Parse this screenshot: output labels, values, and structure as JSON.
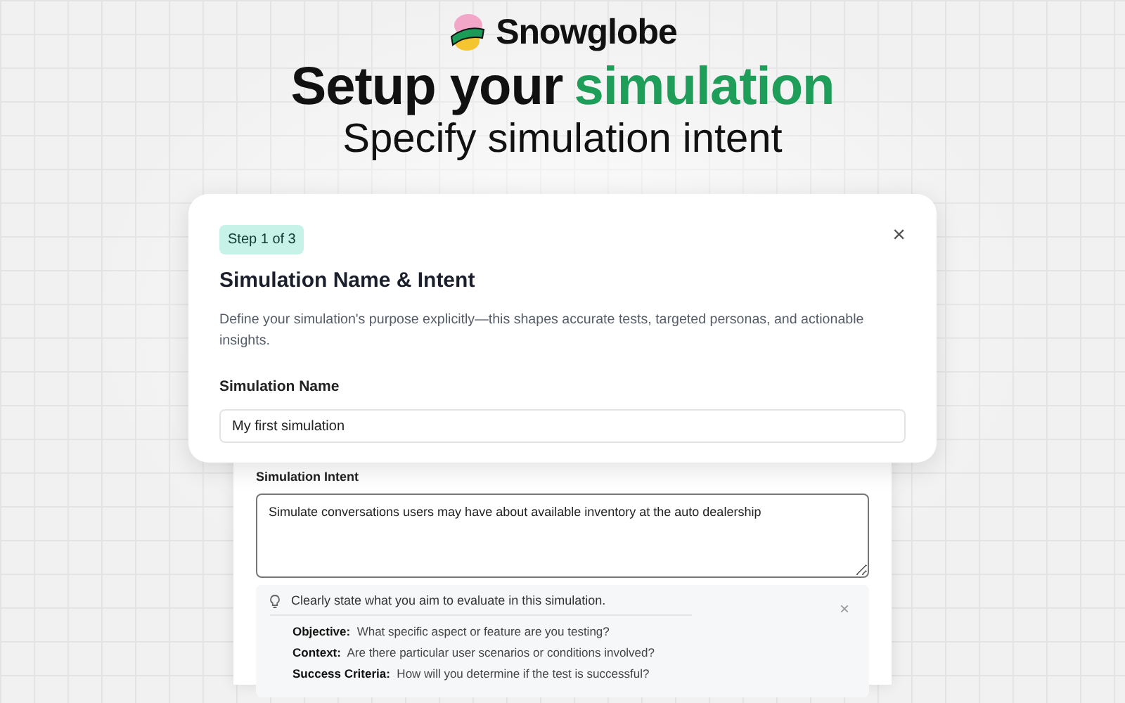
{
  "brand": {
    "name": "Snowglobe"
  },
  "headline": {
    "lead": "Setup your",
    "accent": "simulation"
  },
  "subtitle": "Specify simulation intent",
  "dialog": {
    "step": "Step 1 of 3",
    "title": "Simulation Name & Intent",
    "description": "Define your simulation's purpose explicitly—this shapes accurate tests, targeted personas, and actionable insights.",
    "close": "×",
    "name_label": "Simulation Name",
    "name_value": "My first simulation"
  },
  "intent": {
    "label": "Simulation Intent",
    "value": "Simulate conversations users may have about available inventory at the auto dealership",
    "tip": {
      "text": "Clearly state what you aim to evaluate in this simulation.",
      "close": "×",
      "items": [
        {
          "text": "**Objective:**  What specific aspect or feature are you testing?"
        },
        {
          "text": "**Context:**  Are there particular user scenarios or conditions involved?"
        },
        {
          "text": "**Success Criteria:**  How will you determine if the test is successful?"
        }
      ]
    }
  }
}
